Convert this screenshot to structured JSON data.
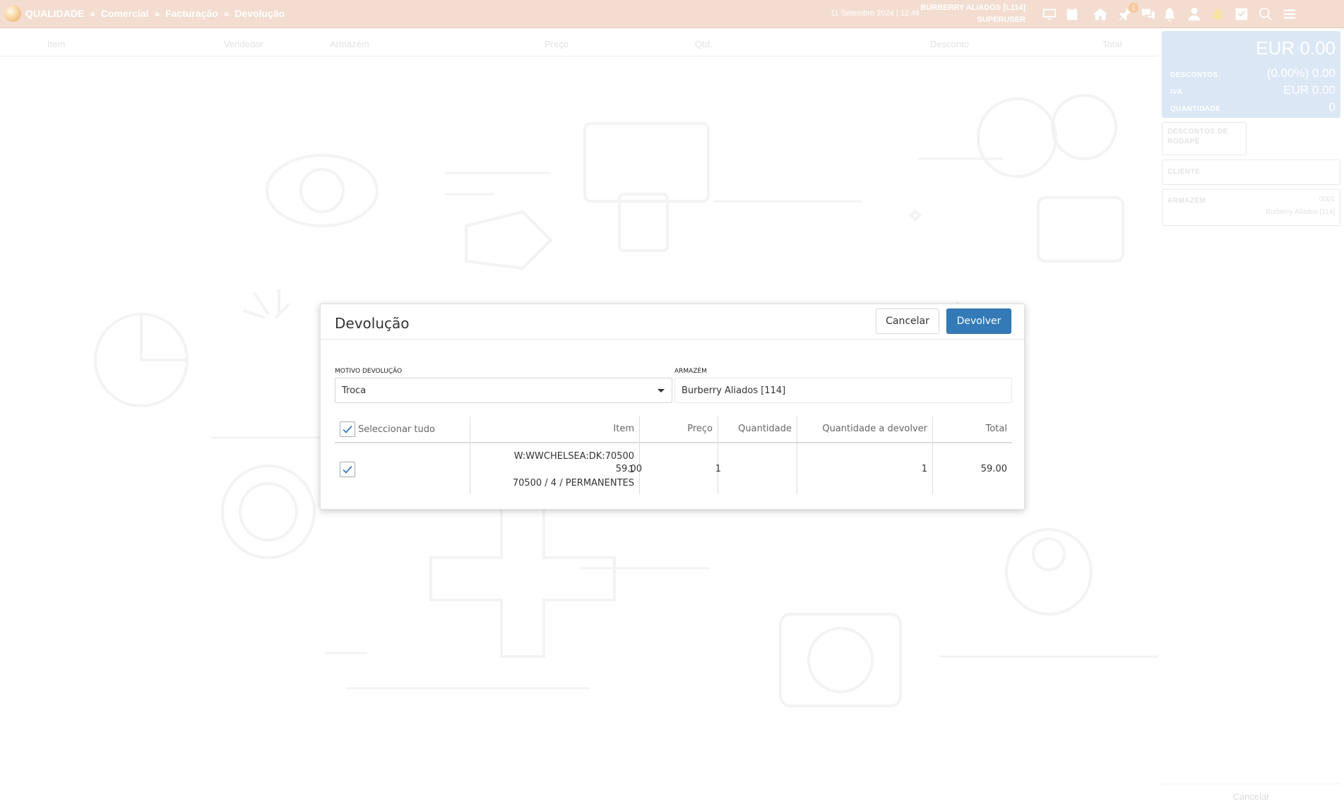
{
  "breadcrumb": {
    "root": "QUALIDADE",
    "separator": "»",
    "items": [
      "Comercial",
      "Facturação",
      "Devolução"
    ]
  },
  "header": {
    "datetime": "11 Setembro 2024 | 12:46",
    "store": "BURBERRY ALIADOS [L114]",
    "role": "SUPERUSER",
    "pin_badge": "1",
    "icons": [
      "monitor-icon",
      "calendar-icon",
      "home-icon",
      "pin-icon",
      "chat-icon",
      "bell-icon",
      "user-icon",
      "bug-icon",
      "checkbox-icon",
      "search-icon",
      "menu-icon"
    ]
  },
  "item_table": {
    "columns": [
      "Item",
      "Vendedor",
      "Armazém",
      "Preço",
      "Qtd.",
      "Desconto",
      "Total"
    ]
  },
  "summary": {
    "total": "EUR 0.00",
    "discounts_label": "DESCONTOS",
    "discounts_value": "(0.00%) 0.00",
    "vat_label": "IVA",
    "vat_value": "EUR 0.00",
    "quantity_label": "QUANTIDADE",
    "quantity_value": "0"
  },
  "panels": {
    "footer_discounts_label": "DESCONTOS DE RODAPÉ",
    "client_label": "CLIENTE",
    "warehouse_label": "ARMAZÉM",
    "warehouse_code": "0001",
    "warehouse_name": "Burberry Aliados [114]",
    "cancel_label": "Cancelar"
  },
  "modal": {
    "title": "Devolução",
    "cancel_label": "Cancelar",
    "return_label": "Devolver",
    "reason_label": "MOTIVO DEVOLUÇÃO",
    "reason_value": "Troca",
    "warehouse_label": "ARMAZÉM",
    "warehouse_value": "Burberry Aliados [114]",
    "select_all_label": "Seleccionar tudo",
    "select_all_checked": true,
    "columns": {
      "item": "Item",
      "price": "Preço",
      "quantity": "Quantidade",
      "quantity_return": "Quantidade a devolver",
      "total": "Total"
    },
    "rows": [
      {
        "checked": true,
        "item_line1": "W:WWCHELSEA:DK:70500",
        "item_line2": "1",
        "item_line3": "70500 / 4 / PERMANENTES",
        "price": "59.00",
        "quantity": "1",
        "quantity_return": "1",
        "total": "59.00"
      }
    ]
  },
  "colors": {
    "topbar": "#f3ddd0",
    "primary_button": "#337ab7",
    "summary_panel": "#dce7f5"
  }
}
